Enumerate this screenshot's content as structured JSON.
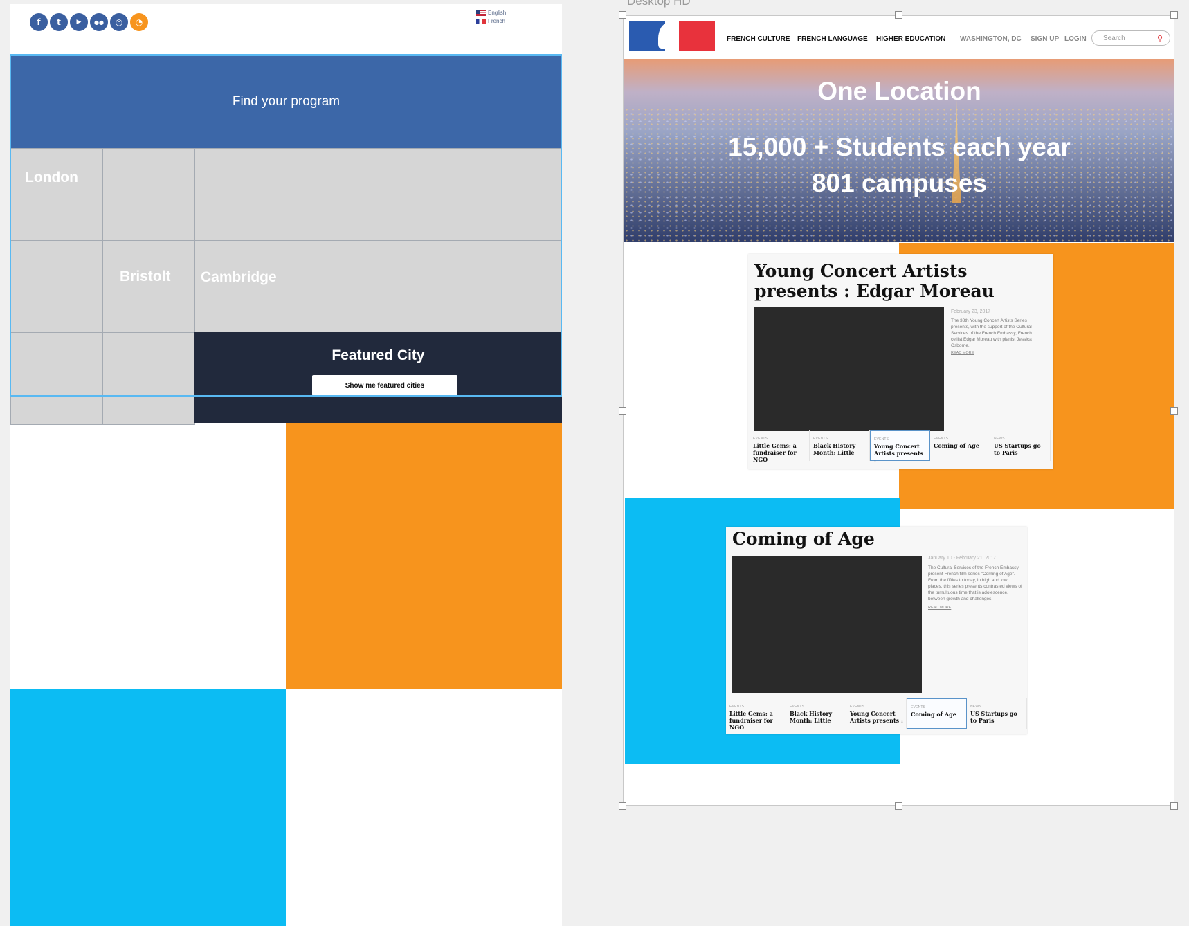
{
  "left": {
    "social_icons": [
      {
        "name": "facebook-icon",
        "glyph": "f"
      },
      {
        "name": "twitter-icon",
        "glyph": "t"
      },
      {
        "name": "youtube-icon",
        "glyph": "▶"
      },
      {
        "name": "flickr-icon",
        "glyph": "●●"
      },
      {
        "name": "instagram-icon",
        "glyph": "◎"
      },
      {
        "name": "rss-icon",
        "glyph": "◔"
      }
    ],
    "languages": [
      "English",
      "French"
    ],
    "find_program": "Find your program",
    "cities": {
      "london": "London",
      "bristol": "Bristolt",
      "cambridge": "Cambridge"
    },
    "featured": {
      "title": "Featured City",
      "button": "Show me featured cities"
    },
    "colors": {
      "blue": "#3c67a8",
      "orange": "#f7941d",
      "cyan": "#0cbcf3",
      "navy": "#21293c"
    }
  },
  "right": {
    "artboard_label": "Desktop HD",
    "nav": {
      "french_culture": "FRENCH CULTURE",
      "french_language": "FRENCH LANGUAGE",
      "higher_education": "HIGHER EDUCATION",
      "location": "WASHINGTON, DC",
      "sign_up": "SIGN UP",
      "login": "LOGIN",
      "search_placeholder": "Search"
    },
    "hero": {
      "line1": "One Location",
      "line2": "15,000 + Students each year",
      "line3": "801 campuses"
    },
    "card1": {
      "title": "Young Concert Artists presents : Edgar Moreau",
      "date": "February 23, 2017",
      "description": "The 38th Young Concert Artists Series presents, with the support of the Cultural Services of the French Embassy, French cellist Edgar Moreau with pianist Jessica Osborne.",
      "read_more": "READ MORE",
      "tabs": [
        {
          "cat": "EVENTS",
          "title": "Little Gems: a fundraiser for NGO"
        },
        {
          "cat": "EVENTS",
          "title": "Black History Month: Little"
        },
        {
          "cat": "EVENTS",
          "title": "Young Concert Artists presents :"
        },
        {
          "cat": "EVENTS",
          "title": "Coming of Age"
        },
        {
          "cat": "NEWS",
          "title": "US Startups go to Paris"
        }
      ]
    },
    "card2": {
      "title": "Coming of Age",
      "date": "January 10 - February 21, 2017",
      "description": "The Cultural Services of the French Embassy present French film series \"Coming of Age\". From the fifties to today, in high and low places, this series presents contrasted views of the tumultuous time that is adolescence, between growth and challenges.",
      "read_more": "READ MORE",
      "tabs": [
        {
          "cat": "EVENTS",
          "title": "Little Gems: a fundraiser for NGO"
        },
        {
          "cat": "EVENTS",
          "title": "Black History Month: Little"
        },
        {
          "cat": "EVENTS",
          "title": "Young Concert Artists presents :"
        },
        {
          "cat": "EVENTS",
          "title": "Coming of Age"
        },
        {
          "cat": "NEWS",
          "title": "US Startups go to Paris"
        }
      ]
    }
  }
}
